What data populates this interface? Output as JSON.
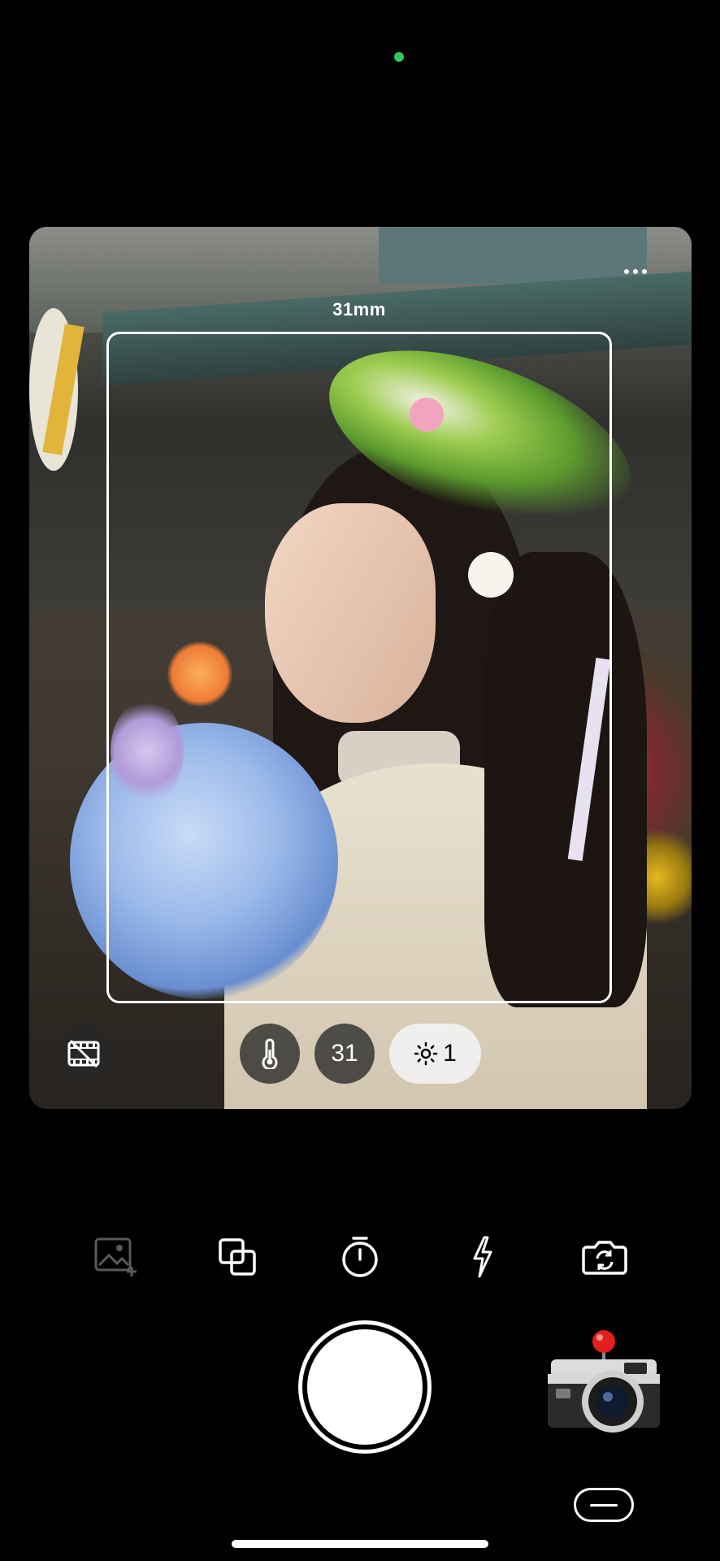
{
  "viewfinder": {
    "focal_length_label": "31mm"
  },
  "quick_controls": {
    "film_icon": "film-off-icon",
    "temperature_icon": "thermometer-icon",
    "focal_value": "31",
    "exposure_icon": "sun-icon",
    "exposure_value": "1"
  },
  "toolbar": {
    "items": [
      {
        "name": "gallery-add-icon",
        "enabled": false
      },
      {
        "name": "double-exposure-icon",
        "enabled": true
      },
      {
        "name": "timer-icon",
        "enabled": true
      },
      {
        "name": "flash-icon",
        "enabled": true
      },
      {
        "name": "switch-camera-icon",
        "enabled": true
      }
    ]
  },
  "colors": {
    "status_dot": "#34c759",
    "background": "#000000",
    "accent": "#ffffff"
  }
}
